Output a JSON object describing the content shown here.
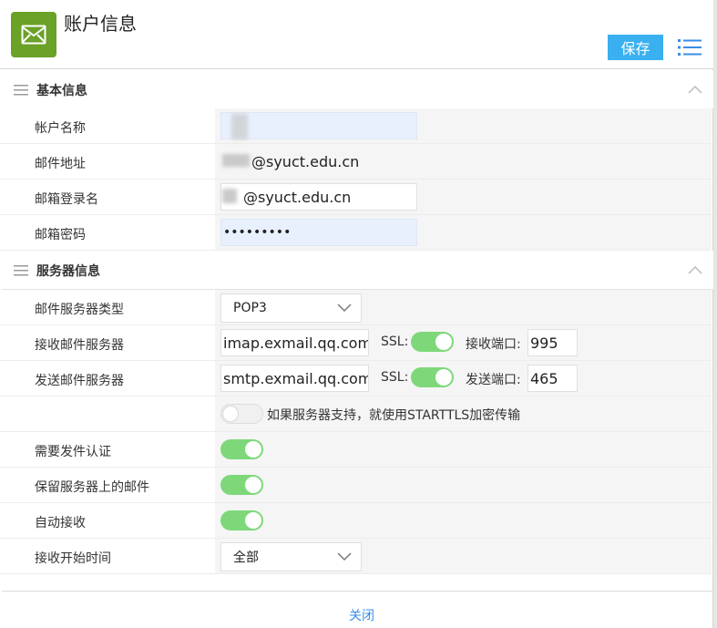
{
  "header": {
    "title": "账户信息",
    "save_label": "保存",
    "app_icon": "mail-icon",
    "menu_icon": "list-menu-icon",
    "accent_color": "#3ab0f0",
    "icon_color": "#6aa127"
  },
  "basic": {
    "title": "基本信息",
    "account_name": {
      "label": "帐户名称",
      "value": ""
    },
    "email": {
      "label": "邮件地址",
      "value": "@syuct.edu.cn"
    },
    "login": {
      "label": "邮箱登录名",
      "value": "@syuct.edu.cn"
    },
    "password": {
      "label": "邮箱密码",
      "value": "•••••••••"
    }
  },
  "server": {
    "title": "服务器信息",
    "type": {
      "label": "邮件服务器类型",
      "value": "POP3"
    },
    "incoming": {
      "label": "接收邮件服务器",
      "host": "imap.exmail.qq.com",
      "ssl_label": "SSL:",
      "ssl": true,
      "port_label": "接收端口:",
      "port": "995"
    },
    "outgoing": {
      "label": "发送邮件服务器",
      "host": "smtp.exmail.qq.com",
      "ssl_label": "SSL:",
      "ssl": true,
      "port_label": "发送端口:",
      "port": "465"
    },
    "starttls": {
      "label": "如果服务器支持，就使用STARTTLS加密传输",
      "enabled": false
    },
    "auth": {
      "label": "需要发件认证",
      "enabled": true
    },
    "keep": {
      "label": "保留服务器上的邮件",
      "enabled": true
    },
    "auto": {
      "label": "自动接收",
      "enabled": true
    },
    "start_time": {
      "label": "接收开始时间",
      "value": "全部"
    }
  },
  "footer": {
    "close_label": "关闭"
  },
  "colors": {
    "toggle_on": "#7ed87a",
    "link": "#3a8ee6"
  }
}
